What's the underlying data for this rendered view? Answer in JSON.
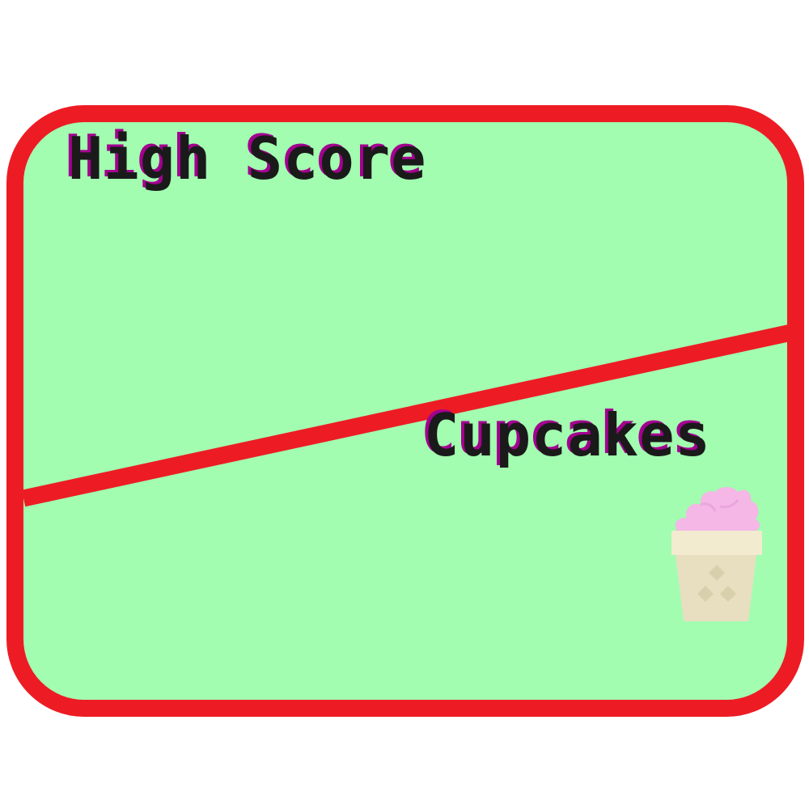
{
  "screen": {
    "high_score_label": "High Score",
    "cupcakes_label": "Cupcakes"
  },
  "icons": {
    "cupcake": "cupcake-icon"
  },
  "colors": {
    "border": "#ed1c24",
    "panel_fill": "#a2fdb0",
    "text": "#1a1a1a",
    "text_shadow": "#a3008f",
    "frosting": "#f4b7e6",
    "cup_band": "#f2ebcf",
    "cup_body": "#e8dfc0"
  }
}
